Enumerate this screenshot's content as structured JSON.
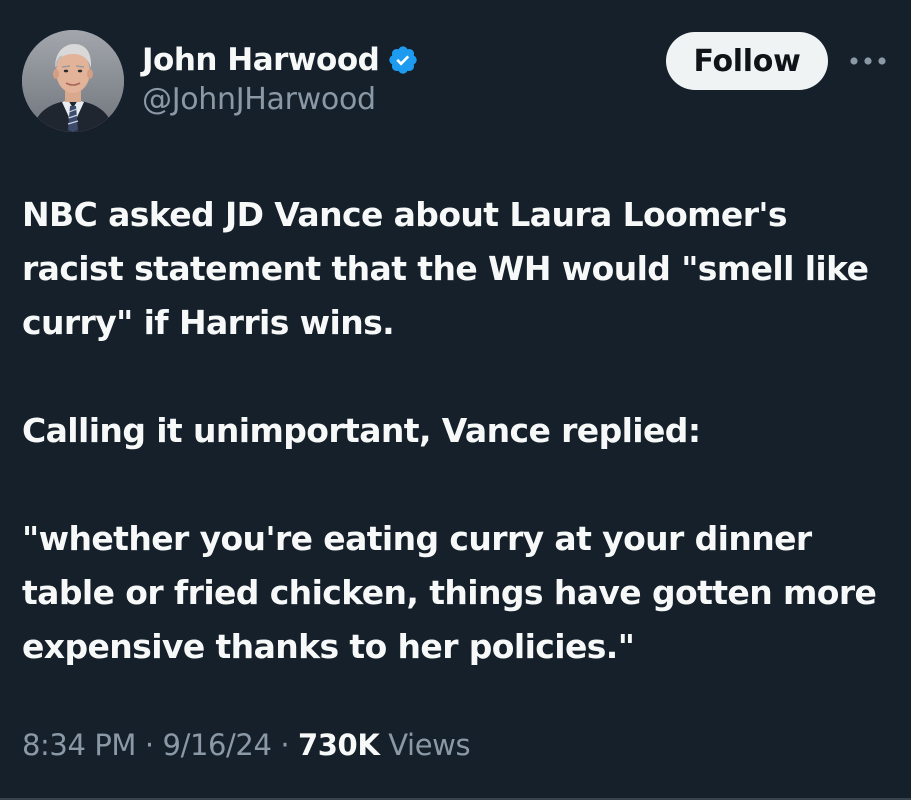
{
  "author": {
    "display_name": "John Harwood",
    "handle": "@JohnJHarwood",
    "verified": true,
    "verified_icon": "verified-badge-icon",
    "verified_color": "#1d9bf0"
  },
  "actions": {
    "follow_label": "Follow",
    "more_icon": "more-horizontal-icon"
  },
  "tweet": {
    "paragraphs": [
      "NBC asked JD Vance about Laura Loomer's racist statement that the WH would \"smell like curry\" if Harris wins.",
      "Calling it unimportant, Vance replied:",
      "\"whether you're eating curry at your dinner table or fried chicken, things have gotten more expensive thanks to her policies.\""
    ]
  },
  "meta": {
    "time": "8:34 PM",
    "separator": " · ",
    "date": "9/16/24",
    "views_count": "730K",
    "views_label": " Views"
  },
  "colors": {
    "background": "#15202b",
    "text": "#f7f9f9",
    "secondary_text": "#8b98a5",
    "follow_bg": "#eff3f4"
  }
}
